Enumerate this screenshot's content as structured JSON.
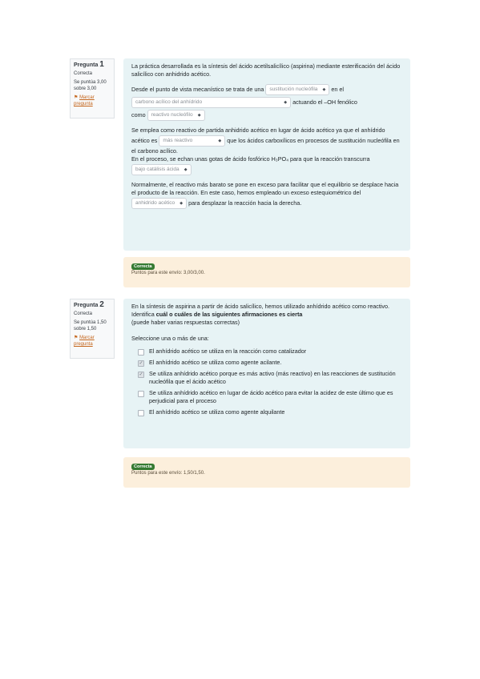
{
  "q1": {
    "info": {
      "label": "Pregunta",
      "number": "1",
      "status": "Correcta",
      "points": "Se puntúa 3,00 sobre 3,00",
      "flag": "Marcar pregunta"
    },
    "p1": "La práctica desarrollada es la síntesis del ácido acetilsalicílico (aspirina) mediante esterificación del ácido salicílico con anhidrido acético.",
    "p2a": "Desde el punto de vista mecanístico se trata de una",
    "sel1": "sustitución nucleófila",
    "p2b": "en el",
    "sel2": "carbono acílico del anhídrido",
    "p2c": "actuando el –OH fenólico",
    "p2d": "como",
    "sel3": "reactivo nucleófilo",
    "p3a": "Se emplea como reactivo de partida anhidrido acético en lugar de ácido acético ya que el anhídrido acético es",
    "sel4": "más reactivo",
    "p3b": "que los ácidos carboxílicos en procesos de sustitución nucleófila en el carbono acílico.",
    "p4a": "En el proceso, se echan unas gotas de ácido fosfórico H₃PO₄ para que la reacción transcurra",
    "sel5": "bajo catálisis ácida",
    "p5a": "Normalmente, el reactivo más barato se pone en exceso para facilitar que el equilibrio se desplace hacia el producto de la reacción. En este caso, hemos empleado un exceso estequiométrico del",
    "sel6": "anhidrido acético",
    "p5b": "para desplazar la reacción hacia la derecha.",
    "feedback": {
      "badge": "Correcta",
      "text": "Puntos para este envío: 3,00/3,00."
    }
  },
  "q2": {
    "info": {
      "label": "Pregunta",
      "number": "2",
      "status": "Correcta",
      "points": "Se puntúa 1,50 sobre 1,50",
      "flag": "Marcar pregunta"
    },
    "intro_a": "En la síntesis de aspirina a partir de ácido salicílico, hemos utilizado anhídrido acético como reactivo. Identifica",
    "intro_bold": "cuál o cuáles de las siguientes afirmaciones es cierta",
    "intro_b": "(puede haber varias respuestas correctas)",
    "prompt": "Seleccione una o más de una:",
    "options": [
      {
        "text": "El anhídrido acético se utiliza en la reacción como catalizador",
        "checked": false
      },
      {
        "text": "El anhídrido acético se utiliza como agente acilante.",
        "checked": true
      },
      {
        "text": "Se utiliza anhídrido acético porque es más activo (más reactivo) en las reacciones de sustitución nucleófila que el ácido acético",
        "checked": true
      },
      {
        "text": "Se utiliza anhídrido acético en lugar de ácido acético para evitar la acidez de este último que es perjudicial para el proceso",
        "checked": false
      },
      {
        "text": "El anhídrido acético se utiliza como agente alquilante",
        "checked": false
      }
    ],
    "feedback": {
      "badge": "Correcta",
      "text": "Puntos para este envío: 1,50/1,50."
    }
  }
}
